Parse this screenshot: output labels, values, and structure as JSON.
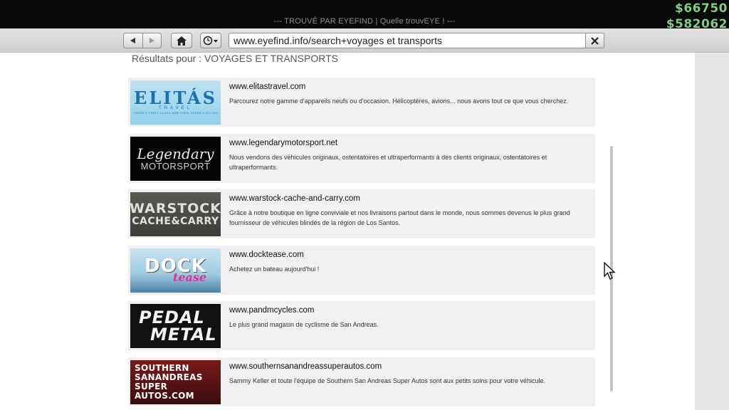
{
  "window": {
    "title": "--- TROUVÉ PAR EYEFIND | Quelle trouvEYE ! ---"
  },
  "hud": {
    "cash": "$66750",
    "bank": "$582062",
    "color": "#7ed27e"
  },
  "toolbar": {
    "back_icon": "triangle-left-icon",
    "forward_icon": "triangle-right-icon",
    "home_icon": "home-icon",
    "history_icon": "clock-dropdown-icon",
    "url": "www.eyefind.info/search+voyages et transports",
    "close_icon": "close-x-icon"
  },
  "search": {
    "heading": "Résultats pour : VOYAGES ET TRANSPORTS"
  },
  "results": [
    {
      "url": "www.elitastravel.com",
      "description": "Parcourez notre gamme d'appareils neufs ou d'occasion. Hélicoptères, avions... nous avons tout ce que vous cherchez.",
      "logo": {
        "line1": "ELITÁS",
        "line2": "TRAVEL",
        "line3": "THERE'S FIRST CLASS AND THEN THERE'S ELITÁS"
      }
    },
    {
      "url": "www.legendarymotorsport.net",
      "description": "Nous vendons des véhicules originaux, ostentatoires et ultraperformants à des clients originaux, ostentatoires et ultraperformants.",
      "logo": {
        "line1": "Legendary",
        "line2": "MOTORSPORT"
      }
    },
    {
      "url": "www.warstock-cache-and-carry.com",
      "description": "Grâce à notre boutique en ligne conviviale et nos livraisons partout dans le monde, nous sommes devenus le plus grand fournisseur de véhicules blindés de la région de Los Santos.",
      "logo": {
        "line1": "WARSTOCK",
        "line2": "CACHE&CARRY"
      }
    },
    {
      "url": "www.docktease.com",
      "description": "Achetez un bateau aujourd'hui !",
      "logo": {
        "line1": "DOCK",
        "line2": "tease"
      }
    },
    {
      "url": "www.pandmcycles.com",
      "description": "Le plus grand magasin de cyclisme de San Andreas.",
      "logo": {
        "line1": "PEDAL",
        "line2": "METAL"
      }
    },
    {
      "url": "www.southernsanandreassuperautos.com",
      "description": "Sammy Keller et toute l'équipe de Southern San Andreas Super Autos sont aux petits soins pour votre véhicule.",
      "logo": {
        "line1": "SOUTHERN",
        "line2": "SANANDREAS",
        "line3": "SUPER",
        "line4": "AUTOS.COM"
      }
    }
  ]
}
